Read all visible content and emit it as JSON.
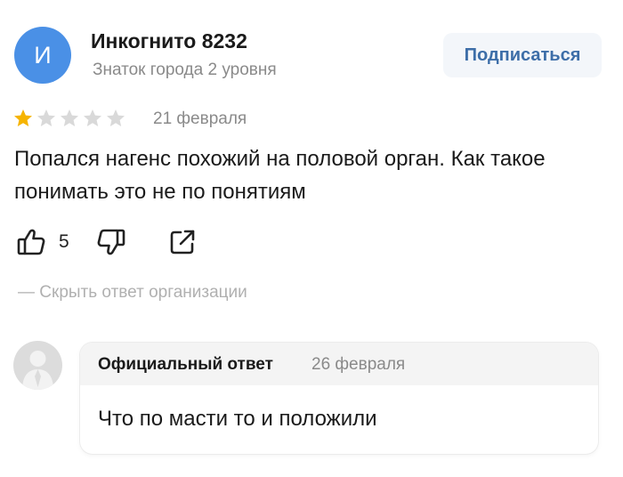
{
  "author": {
    "initial": "И",
    "name": "Инкогнито 8232",
    "level": "Знаток города 2 уровня",
    "avatar_color": "#4a90e6"
  },
  "subscribe_label": "Подписаться",
  "review": {
    "rating": 1,
    "max_rating": 5,
    "date": "21 февраля",
    "text": "Попался нагенс похожий на половой орган. Как такое понимать это не по понятиям",
    "likes": "5"
  },
  "hide_answer_label": "— Скрыть ответ организации",
  "answer": {
    "title": "Официальный ответ",
    "date": "26 февраля",
    "text": "Что по масти то и положили"
  },
  "icons": {
    "like": "thumbs-up-icon",
    "dislike": "thumbs-down-icon",
    "share": "share-icon",
    "star_filled_color": "#f6b400",
    "star_empty_color": "#d9d9d9"
  }
}
